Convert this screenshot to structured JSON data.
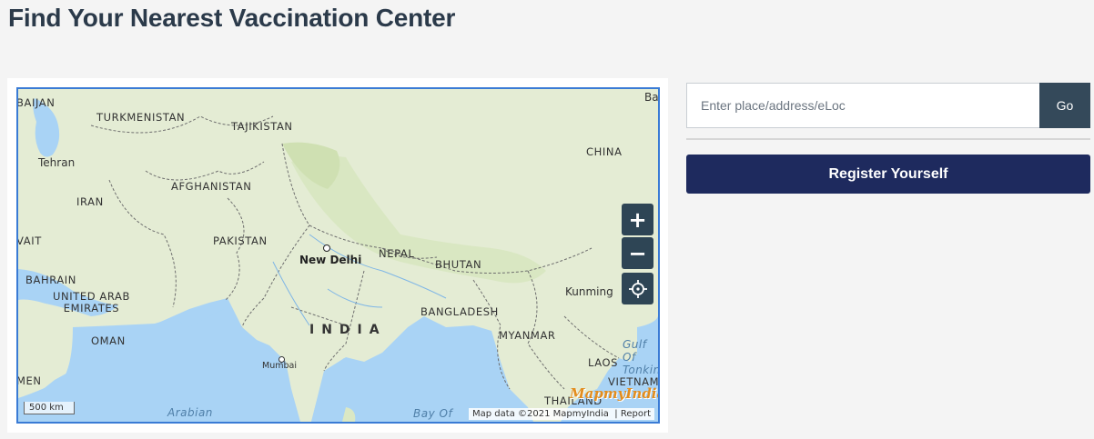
{
  "page": {
    "title": "Find Your Nearest Vaccination Center"
  },
  "search": {
    "placeholder": "Enter place/address/eLoc",
    "value": "",
    "go_label": "Go"
  },
  "register": {
    "label": "Register Yourself"
  },
  "map": {
    "labels": {
      "baijan": "BAIJAN",
      "turkmenistan": "TURKMENISTAN",
      "tajikistan": "TAJIKISTAN",
      "ba": "Ba",
      "china": "CHINA",
      "tehran": "Tehran",
      "afghanistan": "AFGHANISTAN",
      "iran": "IRAN",
      "pakistan": "PAKISTAN",
      "vait": "VAIT",
      "nepal": "NEPAL",
      "new_delhi": "New Delhi",
      "bhutan": "BHUTAN",
      "kunming": "Kunming",
      "bahrain": "BAHRAIN",
      "uae": "UNITED ARAB\nEMIRATES",
      "india": "INDIA",
      "bangladesh": "BANGLADESH",
      "myanmar": "MYANMAR",
      "oman": "OMAN",
      "gulf": "Gulf Of\nTonkin",
      "mumbai": "Mumbai",
      "laos": "LAOS",
      "vietnam": "VIETNAM",
      "men": "MEN",
      "thailand": "THAILAND",
      "arabian": "Arabian",
      "bay_of": "Bay Of"
    },
    "scale": "500 km",
    "attribution": "Map data ©2021 MapmyIndia",
    "report_label": "Report",
    "logo": "MapmyIndia",
    "zoom_in_label": "+",
    "zoom_out_label": "−",
    "icons": {
      "zoom_in": "plus-icon",
      "zoom_out": "minus-icon",
      "locate": "crosshair-icon"
    },
    "colors": {
      "land": "#e4ecd4",
      "water": "#a9d3f5",
      "border": "#5a5a5a"
    }
  }
}
